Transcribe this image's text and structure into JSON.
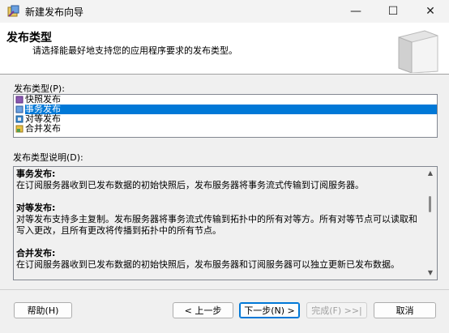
{
  "window": {
    "title": "新建发布向导",
    "min": "—",
    "max": "☐",
    "close": "✕"
  },
  "header": {
    "title": "发布类型",
    "subtitle": "请选择能最好地支持您的应用程序要求的发布类型。"
  },
  "publication_type": {
    "label": "发布类型(P):",
    "items": [
      "快照发布",
      "事务发布",
      "对等发布",
      "合并发布"
    ],
    "selected": "事务发布"
  },
  "description": {
    "label": "发布类型说明(D):",
    "sections": [
      {
        "heading": "事务发布:",
        "text": "在订阅服务器收到已发布数据的初始快照后，发布服务器将事务流式传输到订阅服务器。"
      },
      {
        "heading": "对等发布:",
        "text": "对等发布支持多主复制。发布服务器将事务流式传输到拓扑中的所有对等方。所有对等节点可以读取和写入更改，且所有更改将传播到拓扑中的所有节点。"
      },
      {
        "heading": "合并发布:",
        "text": "在订阅服务器收到已发布数据的初始快照后，发布服务器和订阅服务器可以独立更新已发布数据。"
      }
    ]
  },
  "buttons": {
    "help": "帮助(H)",
    "back": "< 上一步",
    "next": "下一步(N) >",
    "finish": "完成(F) >>|",
    "cancel": "取消"
  }
}
